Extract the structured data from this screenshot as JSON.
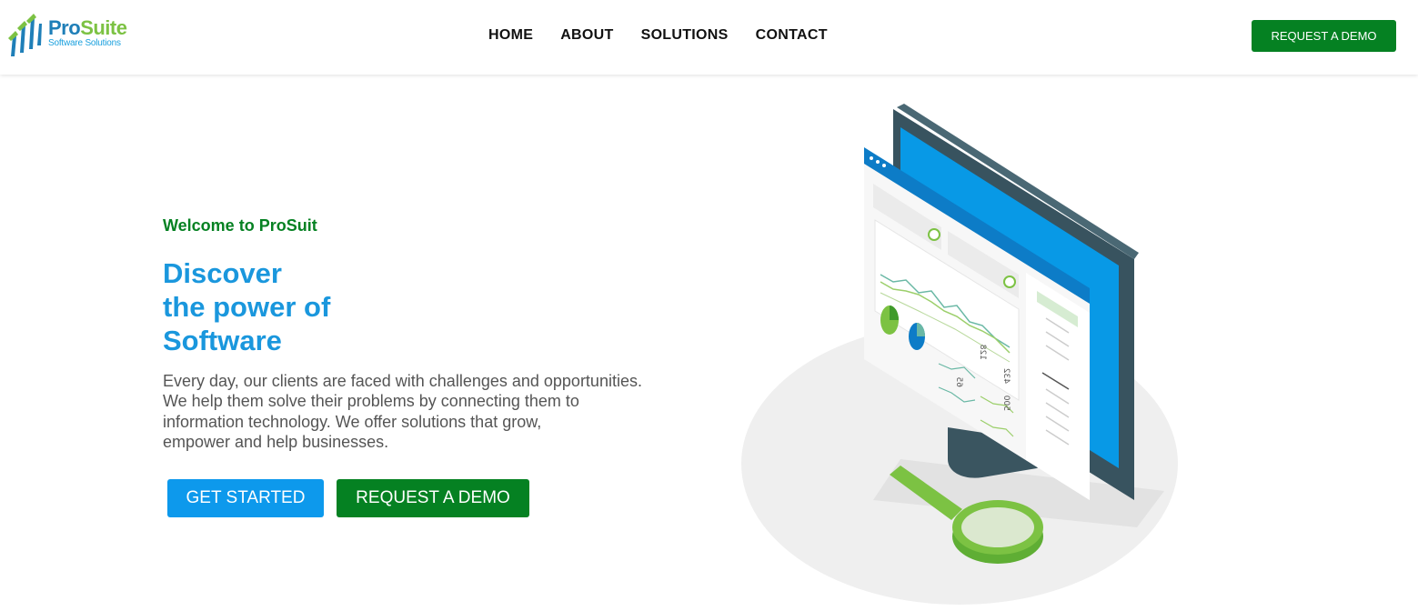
{
  "brand": {
    "name_part1": "Pro",
    "name_part2": "Suite",
    "tagline": "Software Solutions",
    "colors": {
      "blue": "#1f7fb8",
      "green": "#7cc243",
      "tagline": "#1aa0de"
    }
  },
  "nav": {
    "items": [
      {
        "label": "HOME"
      },
      {
        "label": "ABOUT"
      },
      {
        "label": "SOLUTIONS"
      },
      {
        "label": "CONTACT"
      }
    ],
    "cta_label": "REQUEST A DEMO"
  },
  "hero": {
    "welcome": "Welcome to ProSuit",
    "headline_lines": [
      "Discover",
      "the power of",
      "Software"
    ],
    "description": "Every day, our clients are faced with challenges and opportunities.\nWe help them solve their problems by connecting them to\ninformation technology. We offer solutions that grow,\nempower and help businesses.",
    "primary_button": "GET STARTED",
    "secondary_button": "REQUEST A DEMO"
  },
  "illustration": {
    "screen_labels": [
      "128",
      "432",
      "500",
      "65"
    ]
  },
  "colors": {
    "accent_green": "#058122",
    "accent_blue": "#0d99ec",
    "headline_blue": "#1a97dd",
    "text_gray": "#555555"
  }
}
